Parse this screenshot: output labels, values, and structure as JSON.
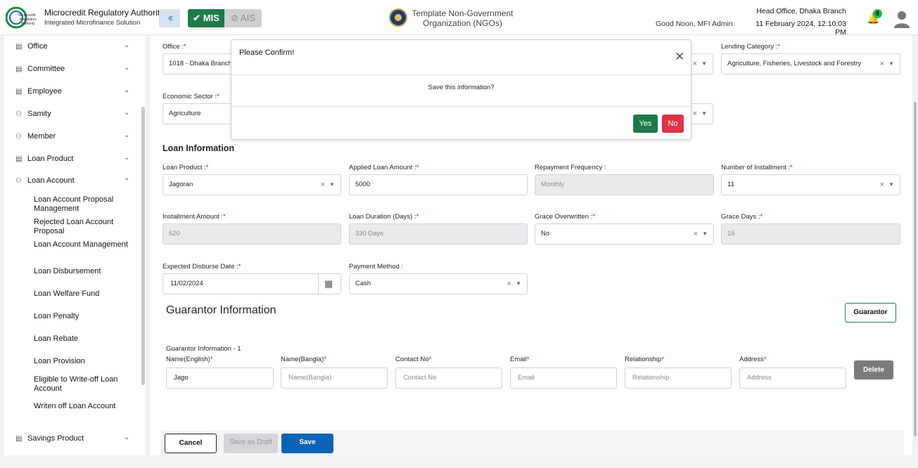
{
  "header": {
    "org_name": "Microcredit Regulatory Authority",
    "org_sub": "Integrated Microfinance Solution",
    "mis_label": "MIS",
    "ais_label": "AIS",
    "ngo_line1": "Template Non-Government",
    "ngo_line2": "Organization (NGOs)",
    "greeting": "Good Noon, MFI Admin",
    "branch": "Head Office, Dhaka Branch",
    "datetime": "11 February 2024, 12:10:03 PM",
    "notification_count": "8"
  },
  "sidebar": {
    "items": [
      {
        "label": "Office",
        "icon": "building-icon"
      },
      {
        "label": "Committee",
        "icon": "building-icon"
      },
      {
        "label": "Employee",
        "icon": "building-icon"
      },
      {
        "label": "Samity",
        "icon": "group-icon"
      },
      {
        "label": "Member",
        "icon": "group-icon"
      },
      {
        "label": "Loan Product",
        "icon": "building-icon"
      },
      {
        "label": "Loan Account",
        "icon": "group-icon"
      },
      {
        "label": "Savings Product",
        "icon": "building-icon"
      }
    ],
    "loan_account_sub": [
      "Loan Account Proposal Management",
      "Rejected Loan Account Proposal",
      "Loan Account Management",
      "Loan Disbursement",
      "Loan Welfare Fund",
      "Loan Penalty",
      "Loan Rebate",
      "Loan Provision",
      "Eligible to Write-off Loan Account",
      "Writen off Loan Account"
    ]
  },
  "form": {
    "office_label": "Office :",
    "office_value": "1018 - Dhaka Branch",
    "lending_label": "Lending Category :",
    "lending_value": "Agriculture, Fisheries, Livestock and Forestry",
    "econ_label": "Economic Sector :",
    "econ_value": "Agriculture",
    "loan_info_title": "Loan Information",
    "loan_product_label": "Loan Product :",
    "loan_product_value": "Jagoran",
    "applied_amount_label": "Applied Loan Amount :",
    "applied_amount_value": "5000",
    "repay_freq_label": "Repayment Frequency :",
    "repay_freq_value": "Monthly",
    "num_install_label": "Number of Installment :",
    "num_install_value": "11",
    "install_amount_label": "Installment Amount :",
    "install_amount_value": "520",
    "duration_label": "Loan Duration (Days) :",
    "duration_value": "330 Days",
    "grace_over_label": "Grace Overwritten :",
    "grace_over_value": "No",
    "grace_days_label": "Grace Days :",
    "grace_days_value": "15",
    "disburse_label": "Expected Disburse Date :",
    "disburse_value": "11/02/2024",
    "payment_label": "Payment Method :",
    "payment_value": "Cash"
  },
  "guarantor": {
    "title": "Guarantor Information",
    "button": "Guarantor",
    "subtitle": "Guarantor Information - 1",
    "name_en_label": "Name(English)",
    "name_en_value": "Jago",
    "name_bn_label": "Name(Bangla)",
    "name_bn_ph": "Name(Bangla)",
    "contact_label": "Contact No",
    "contact_ph": "Contact No",
    "email_label": "Email",
    "email_ph": "Email",
    "relation_label": "Relationship",
    "relation_ph": "Relationship",
    "address_label": "Address",
    "address_ph": "Address",
    "delete": "Delete"
  },
  "actions": {
    "cancel": "Cancel",
    "draft": "Save as Draft",
    "save": "Save"
  },
  "dialog": {
    "title": "Please Confirm!",
    "message": "Save this information?",
    "yes": "Yes",
    "no": "No"
  },
  "colors": {
    "primary_green": "#1e7a4a",
    "danger_red": "#dc3545",
    "save_blue": "#0d63b5"
  }
}
